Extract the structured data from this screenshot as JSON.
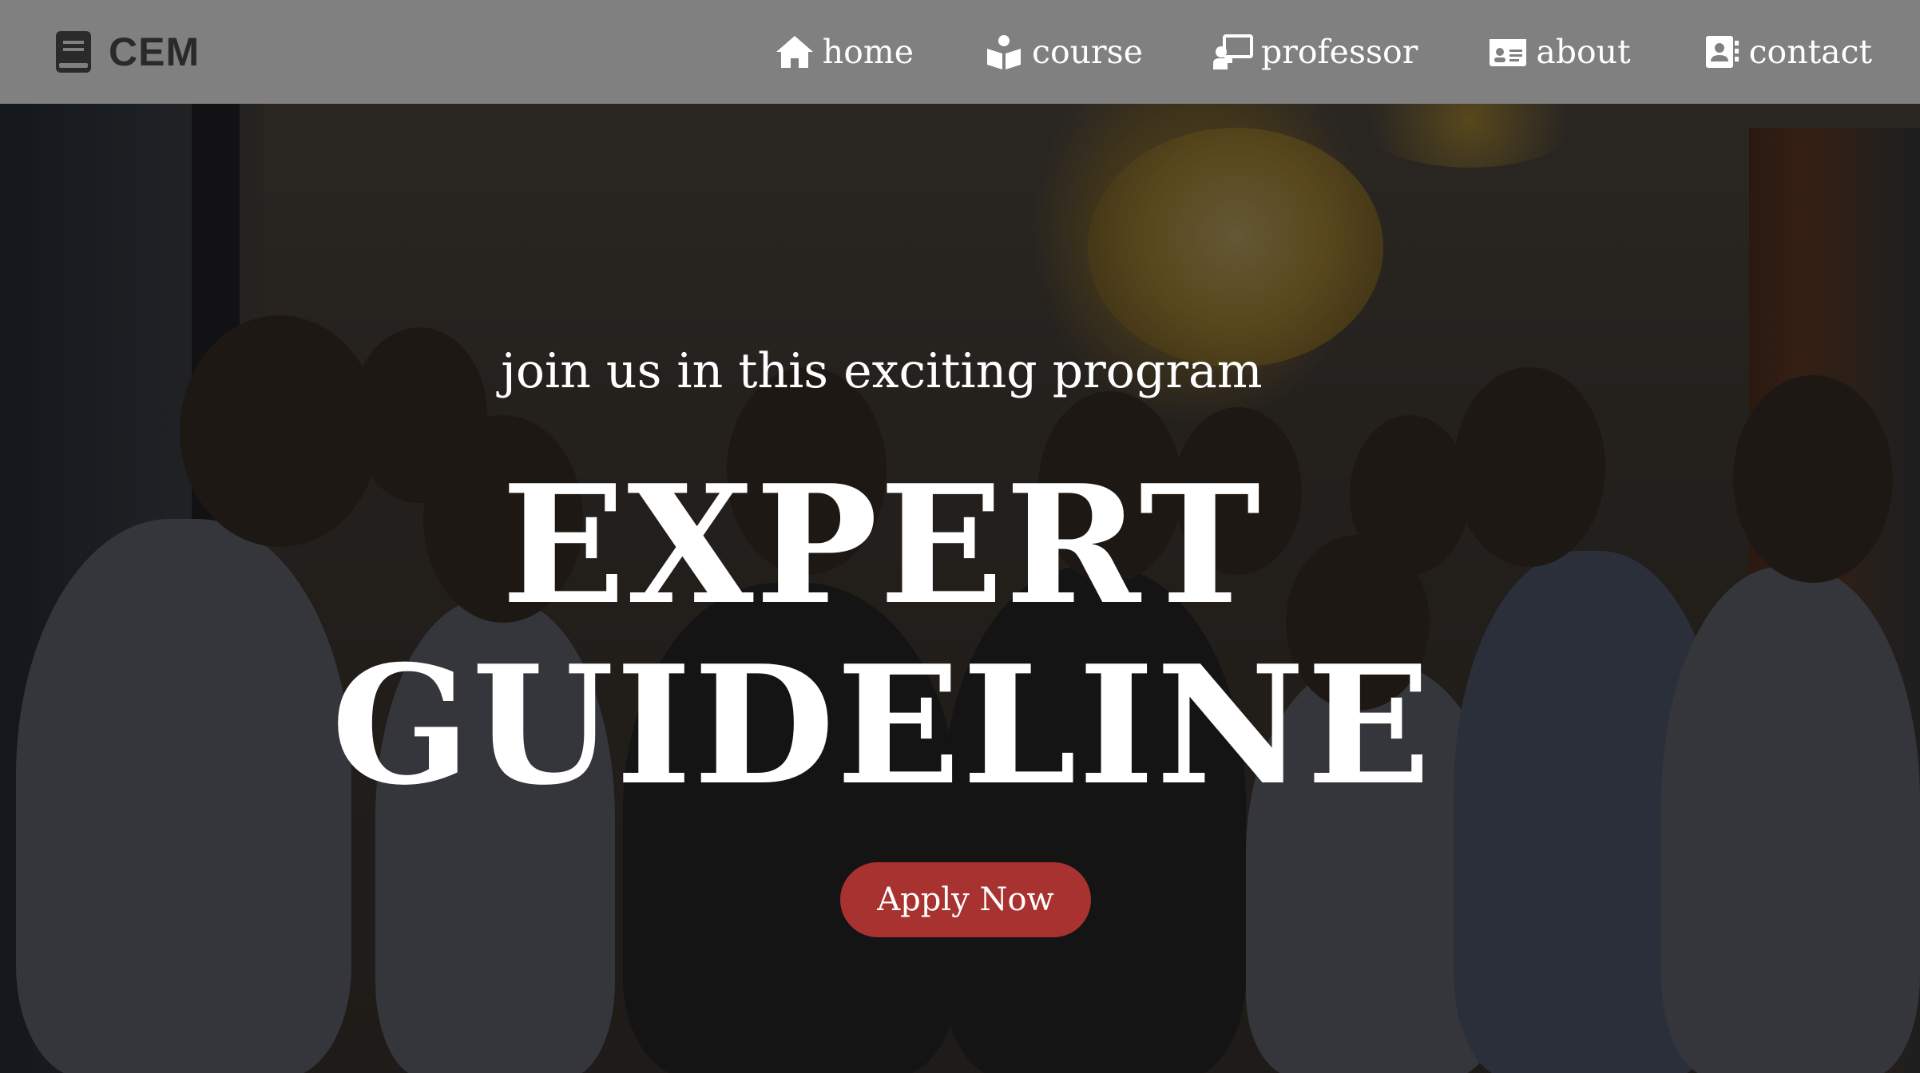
{
  "navbar": {
    "brand": {
      "icon": "book-icon",
      "label": "CEM"
    },
    "items": [
      {
        "icon": "home-icon",
        "label": "home"
      },
      {
        "icon": "book-reader-icon",
        "label": "course"
      },
      {
        "icon": "chalkboard-teacher-icon",
        "label": "professor"
      },
      {
        "icon": "id-card-icon",
        "label": "about"
      },
      {
        "icon": "address-book-icon",
        "label": "contact"
      }
    ]
  },
  "hero": {
    "tagline": "join us in this exciting program",
    "headline_line1": "EXPERT",
    "headline_line2": "GUIDELINE",
    "cta_label": "Apply Now",
    "background": "group-photo"
  },
  "colors": {
    "navbar_bg": "#808080",
    "brand_text": "#2a2a2a",
    "nav_text": "#ffffff",
    "cta_bg": "#a83230",
    "hero_text": "#ffffff"
  }
}
